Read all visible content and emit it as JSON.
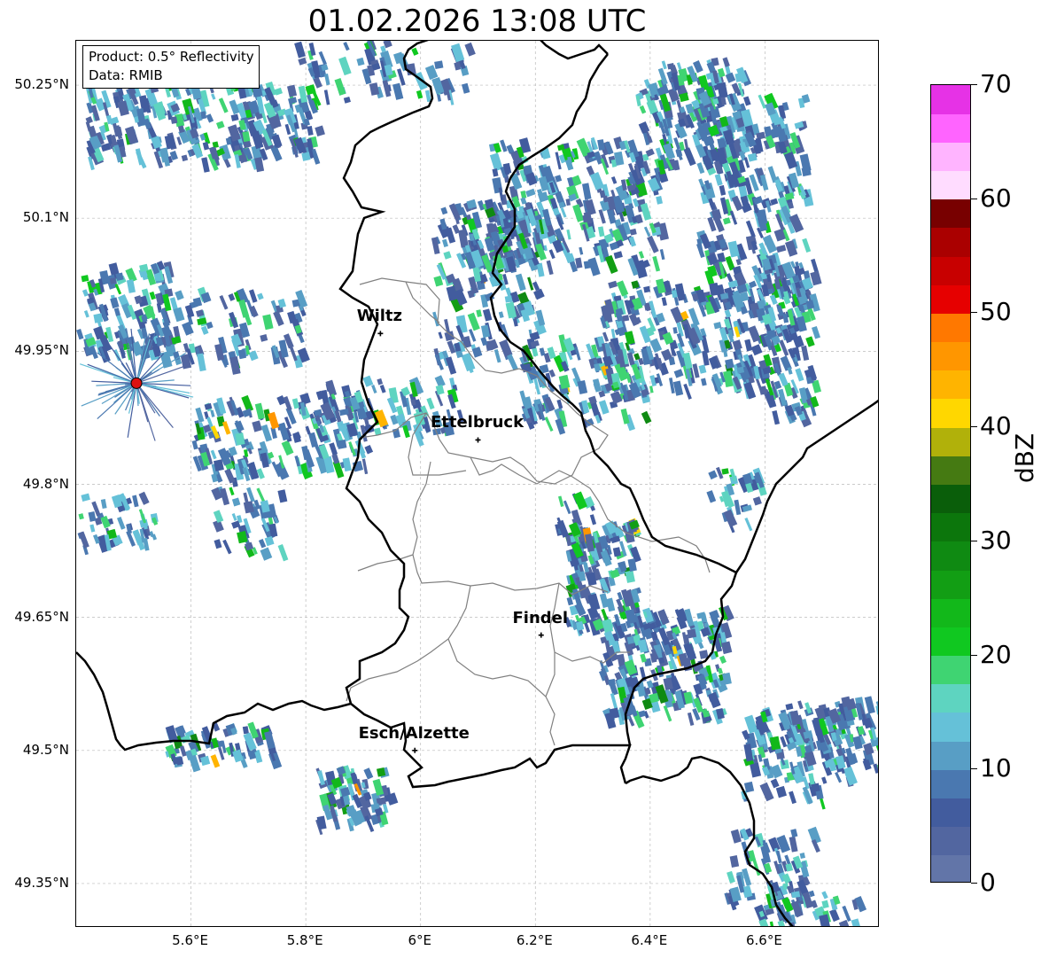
{
  "title": "01.02.2026 13:08 UTC",
  "info": {
    "product": "Product: 0.5° Reflectivity",
    "source": "Data: RMIB"
  },
  "lat_ticks": [
    "50.25°N",
    "50.1°N",
    "49.95°N",
    "49.8°N",
    "49.65°N",
    "49.5°N",
    "49.35°N"
  ],
  "lon_ticks": [
    "5.6°E",
    "5.8°E",
    "6°E",
    "6.2°E",
    "6.4°E",
    "6.6°E"
  ],
  "cities": [
    {
      "name": "Wiltz",
      "lon": 5.93,
      "lat": 49.97
    },
    {
      "name": "Ettelbruck",
      "lon": 6.1,
      "lat": 49.85
    },
    {
      "name": "Findel",
      "lon": 6.21,
      "lat": 49.63
    },
    {
      "name": "Esch/Alzette",
      "lon": 5.99,
      "lat": 49.5
    }
  ],
  "radar_site": {
    "lon": 5.505,
    "lat": 49.914,
    "color": "#dd1111"
  },
  "map_extent": {
    "lon_min": 5.4,
    "lon_max": 6.8,
    "lat_min": 49.3,
    "lat_max": 50.3
  },
  "colorbar": {
    "label": "dBZ",
    "ticks": [
      "0",
      "10",
      "20",
      "30",
      "40",
      "50",
      "60",
      "70"
    ],
    "min": 0,
    "max": 70,
    "step": 2.5,
    "colors": [
      "#6275a8",
      "#5266a0",
      "#425c9e",
      "#4a78b0",
      "#589ec5",
      "#65c1d8",
      "#5ed4c0",
      "#3fd472",
      "#10c820",
      "#12b81a",
      "#129e14",
      "#0f8a12",
      "#0c760c",
      "#0a5e0a",
      "#457a12",
      "#b1b10a",
      "#ffd700",
      "#ffb400",
      "#ff9600",
      "#ff7800",
      "#e60000",
      "#c80000",
      "#aa0000",
      "#780000",
      "#ffdcff",
      "#ffb4ff",
      "#ff64ff",
      "#e632e6"
    ]
  },
  "colors": {
    "border": "#000000",
    "canton": "#808080",
    "grid": "#bbbbbb"
  }
}
